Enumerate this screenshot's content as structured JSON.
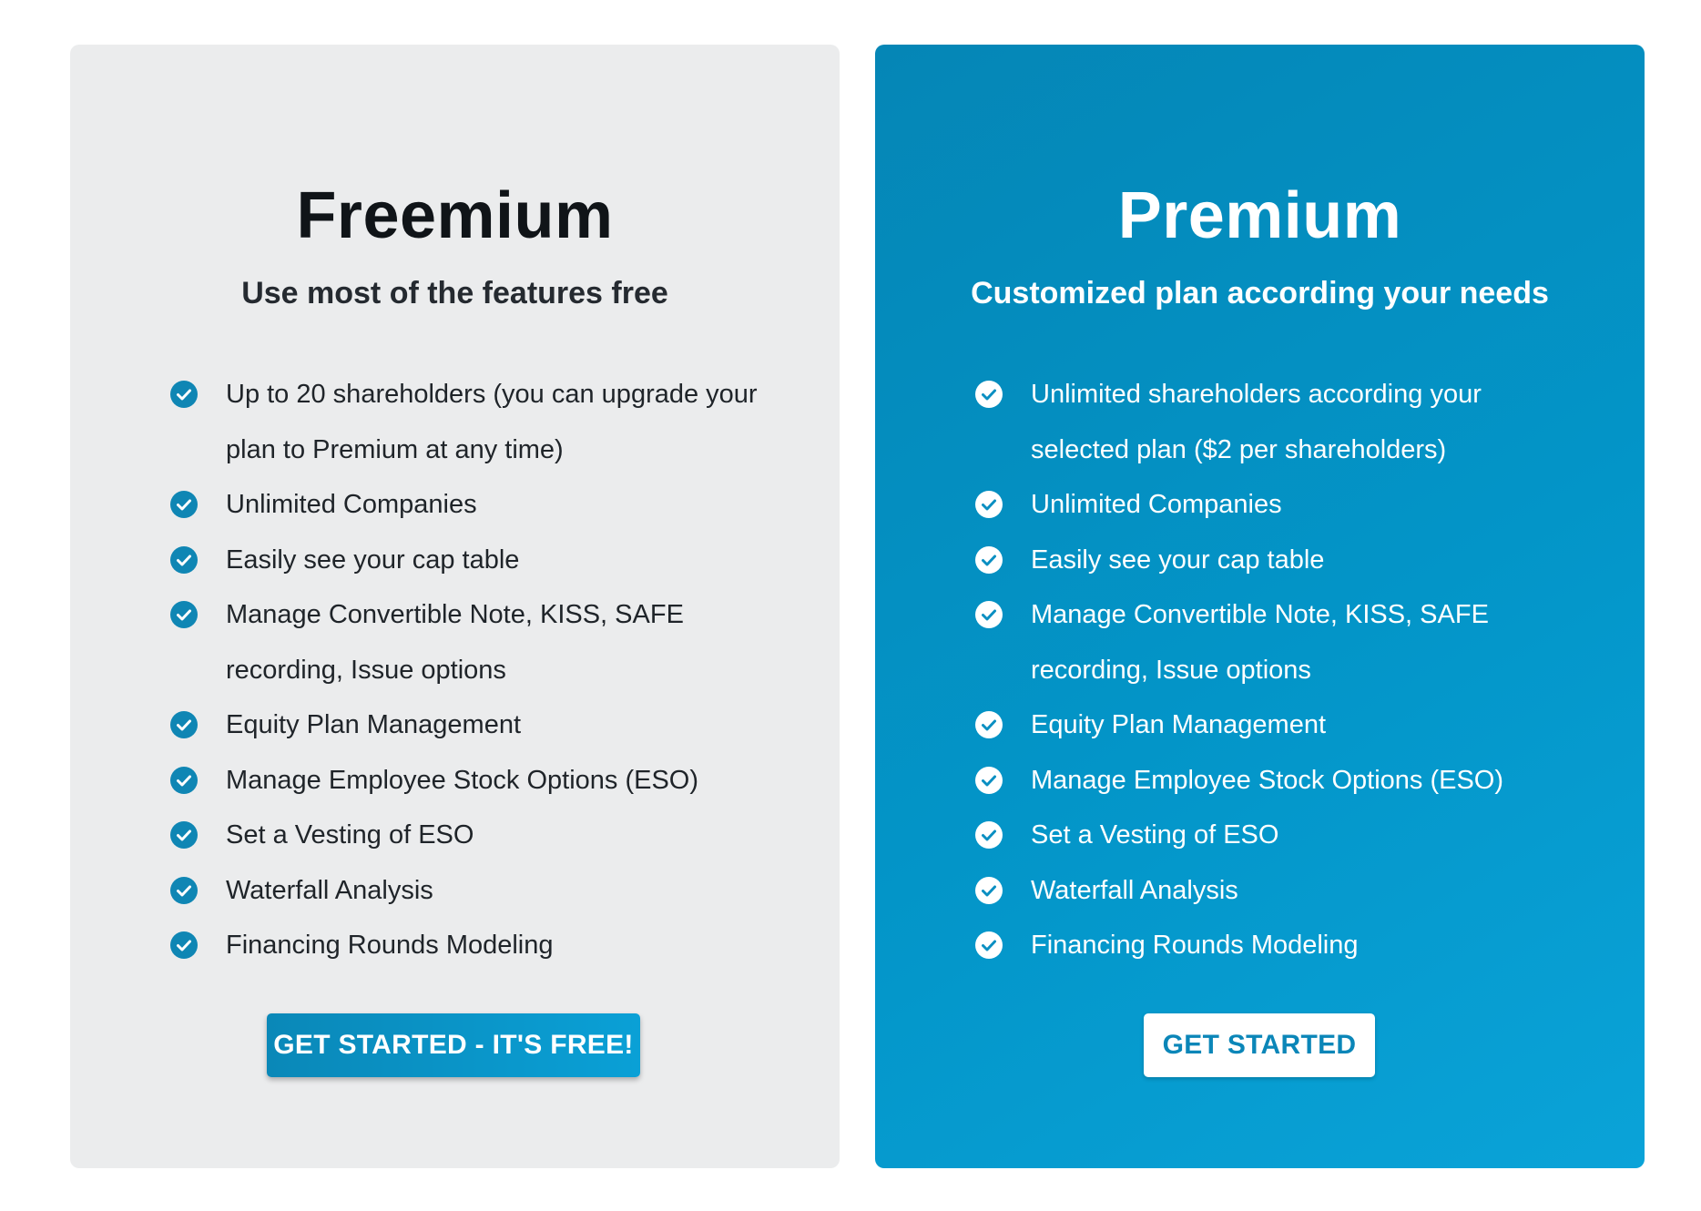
{
  "colors": {
    "freemium_card_bg": "#ebeced",
    "premium_card_bg": "#0395c8",
    "accent": "#0f86b4"
  },
  "plans": [
    {
      "title": "Freemium",
      "subtitle": "Use most of the features free",
      "features": [
        "Up to 20 shareholders (you can upgrade your plan to Premium at any time)",
        "Unlimited Companies",
        "Easily see your cap table",
        "Manage Convertible Note, KISS, SAFE recording, Issue options",
        "Equity Plan Management",
        "Manage Employee Stock Options (ESO)",
        "Set a Vesting of ESO",
        "Waterfall Analysis",
        "Financing Rounds Modeling"
      ],
      "feature_icon": "check-circle-icon",
      "cta_label": "GET STARTED - IT'S FREE!"
    },
    {
      "title": "Premium",
      "subtitle": "Customized plan according your needs",
      "features": [
        "Unlimited shareholders according your selected plan ($2 per shareholders)",
        "Unlimited Companies",
        "Easily see your cap table",
        "Manage Convertible Note, KISS, SAFE recording, Issue options",
        "Equity Plan Management",
        "Manage Employee Stock Options (ESO)",
        "Set a Vesting of ESO",
        "Waterfall Analysis",
        "Financing Rounds Modeling"
      ],
      "feature_icon": "check-circle-icon",
      "cta_label": "GET STARTED"
    }
  ]
}
